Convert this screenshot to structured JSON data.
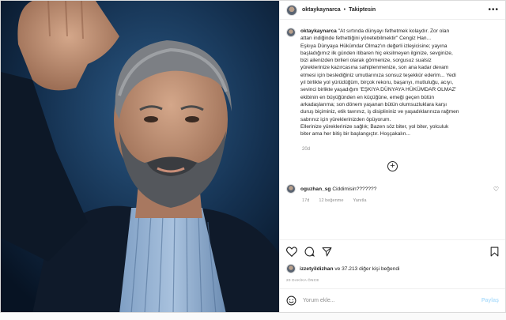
{
  "header": {
    "username": "oktaykaynarca",
    "separator": "•",
    "follow_label": "Takiptesin",
    "more_label": "•••"
  },
  "caption": {
    "username": "oktaykaynarca",
    "lines": [
      "\"At sırtında dünyayı fethetmek kolaydır. Zor olan",
      "attan indiğinde fethettiğini yönetebilmektir\" Cengiz Han...",
      "Eşkıya Dünyaya Hükümdar Olmaz'ın değerli izleyicisine; yayına",
      "başladığımız ilk günden itibaren hiç eksilmeyen ilginize, sevginize,",
      "bizi ailenizden birileri olarak görmenize, sorgusuz sualsiz",
      "yüreklerinize kazırcasına sahiplenmenize, son ana kadar devam",
      "etmesi için beslediğiniz umutlarınıza sonsuz teşekkür ederim... Yedi",
      "yıl birlikte yol yürüdüğüm, birçok rekoru, başarıyı, mutluluğu, acıyı,",
      "sevinci birlikte yaşadığım 'EŞKIYA DÜNYAYA HÜKÜMDAR OLMAZ'",
      "ekibinin en büyüğünden en küçüğüne, emeği geçen bütün",
      "arkadaşlarıma; son dönem yaşanan bütün olumsuzluklara karşı",
      "duruş biçiminiz, etik tavrınız, iş disiplininiz ve yaşadıklarınıza rağmen",
      "sabrınız için yüreklerinizden öpüyorum.",
      "Ellerinize yüreklerinize sağlık; Bazen söz biter, yol biter, yolculuk",
      "biter ama her bitiş bir başlangıçtır. Hoşçakalın..."
    ],
    "time": "20d"
  },
  "load_more": "+",
  "comment": {
    "username": "oguzhan_sg",
    "text": "Ciddimisin???????",
    "time": "17d",
    "likes": "12 beğenme",
    "reply": "Yanıtla"
  },
  "icons": [
    "heart-icon",
    "comment-icon",
    "share-icon",
    "bookmark-icon"
  ],
  "likes": {
    "first": "izzetyildizhan",
    "rest": " ve 37.213 diğer kişi beğendi"
  },
  "ago": "20 DAKİKA ÖNCE",
  "add_comment": {
    "placeholder": "Yorum ekle...",
    "post_label": "Paylaş",
    "emoji_icon": "smiley-icon"
  }
}
